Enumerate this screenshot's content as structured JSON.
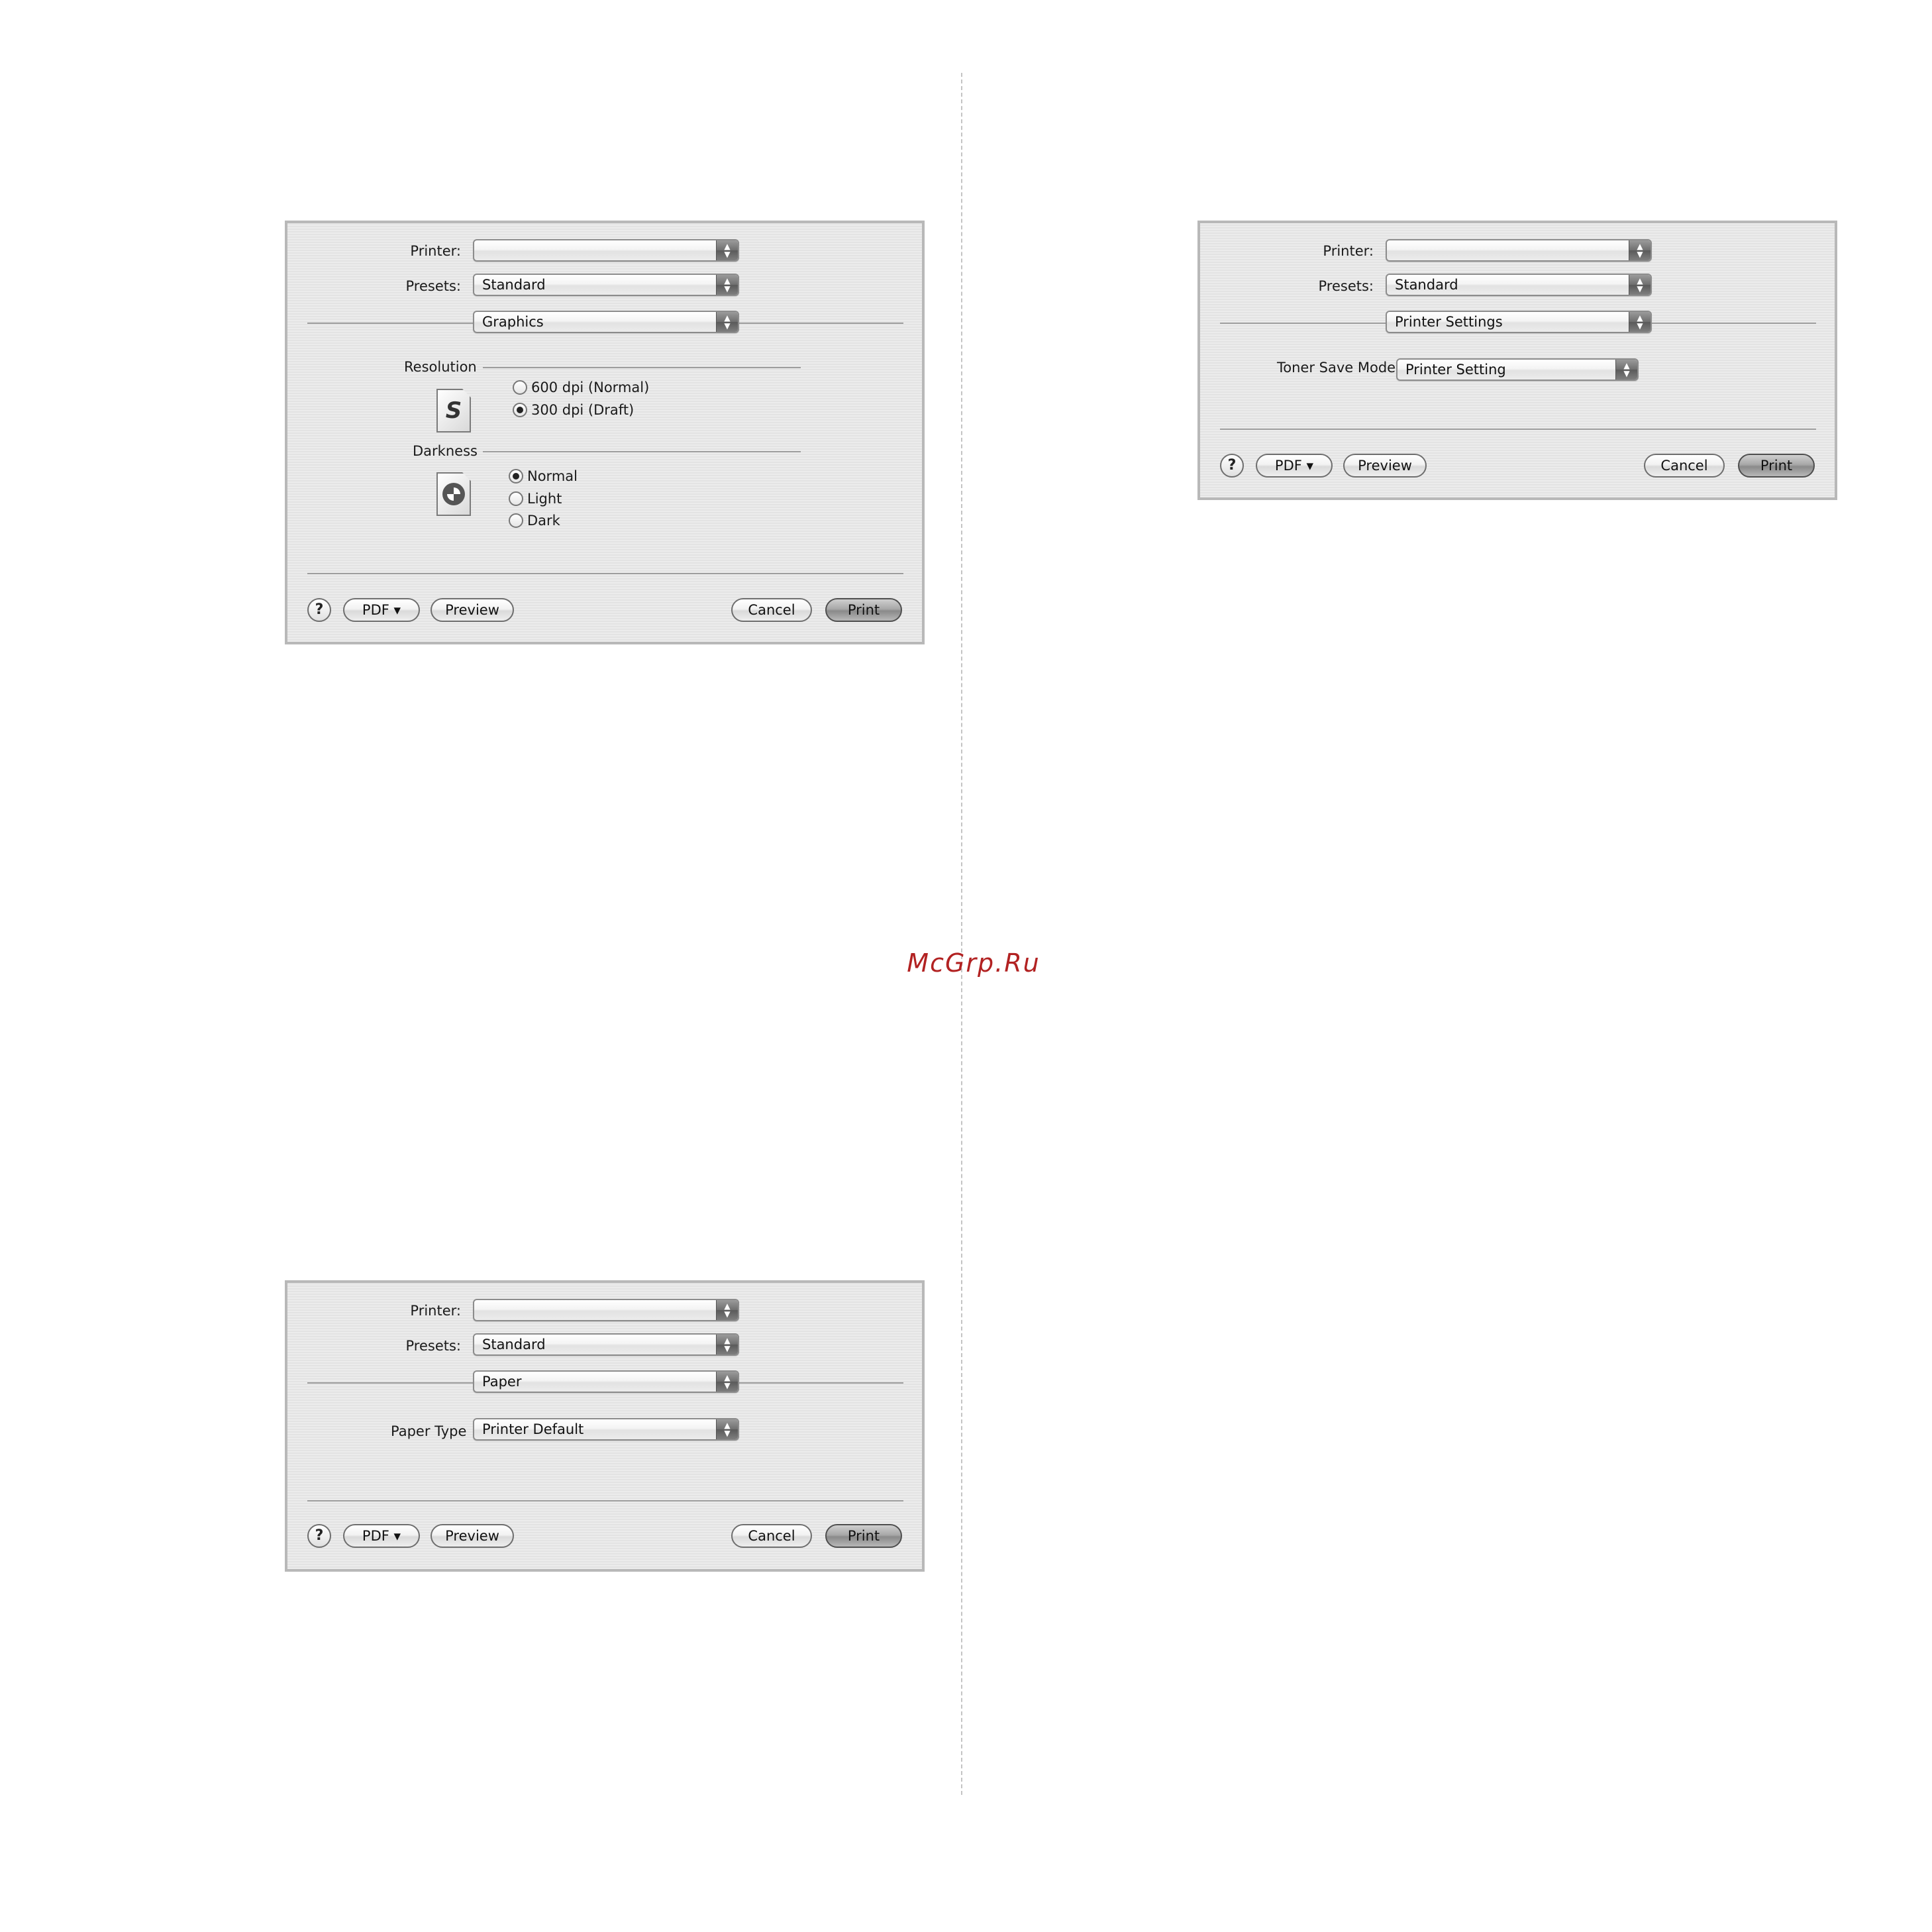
{
  "watermark": "McGrp.Ru",
  "dialogs": {
    "graphics": {
      "printer_label": "Printer:",
      "printer_value": "",
      "presets_label": "Presets:",
      "presets_value": "Standard",
      "panel_value": "Graphics",
      "resolution_label": "Resolution",
      "resolution_options": [
        "600 dpi (Normal)",
        "300 dpi (Draft)"
      ],
      "resolution_selected": "300 dpi (Draft)",
      "darkness_label": "Darkness",
      "darkness_options": [
        "Normal",
        "Light",
        "Dark"
      ],
      "darkness_selected": "Normal",
      "help": "?",
      "pdf": "PDF ▾",
      "preview": "Preview",
      "cancel": "Cancel",
      "print": "Print"
    },
    "printer_settings": {
      "printer_label": "Printer:",
      "printer_value": "",
      "presets_label": "Presets:",
      "presets_value": "Standard",
      "panel_value": "Printer Settings",
      "toner_label": "Toner Save Mode",
      "toner_value": "Printer Setting",
      "help": "?",
      "pdf": "PDF ▾",
      "preview": "Preview",
      "cancel": "Cancel",
      "print": "Print"
    },
    "paper": {
      "printer_label": "Printer:",
      "printer_value": "",
      "presets_label": "Presets:",
      "presets_value": "Standard",
      "panel_value": "Paper",
      "paper_type_label": "Paper Type",
      "paper_type_value": "Printer Default",
      "help": "?",
      "pdf": "PDF ▾",
      "preview": "Preview",
      "cancel": "Cancel",
      "print": "Print"
    }
  }
}
